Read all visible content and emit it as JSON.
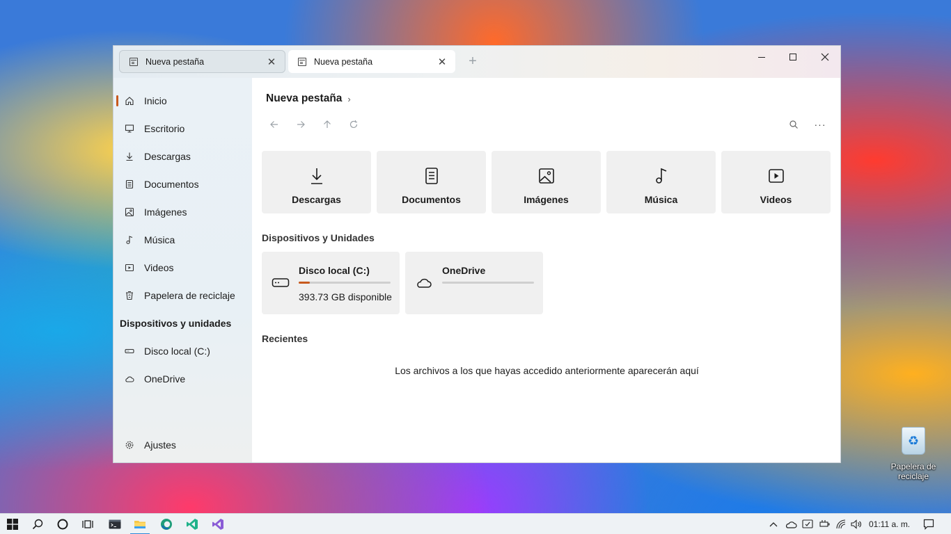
{
  "window": {
    "tabs": [
      {
        "title": "Nueva  pestaña",
        "active": false
      },
      {
        "title": "Nueva  pestaña",
        "active": true
      }
    ],
    "new_tab": "+"
  },
  "sidebar": {
    "items": [
      {
        "label": "Inicio",
        "icon": "home-icon"
      },
      {
        "label": "Escritorio",
        "icon": "desktop-icon"
      },
      {
        "label": "Descargas",
        "icon": "download-icon"
      },
      {
        "label": "Documentos",
        "icon": "document-icon"
      },
      {
        "label": "Imágenes",
        "icon": "image-icon"
      },
      {
        "label": "Música",
        "icon": "music-icon"
      },
      {
        "label": "Videos",
        "icon": "video-icon"
      },
      {
        "label": "Papelera de reciclaje",
        "icon": "recycle-bin-icon"
      }
    ],
    "devices_header": "Dispositivos y unidades",
    "devices": [
      {
        "label": "Disco local (C:)",
        "icon": "drive-icon"
      },
      {
        "label": "OneDrive",
        "icon": "cloud-icon"
      }
    ],
    "settings_label": "Ajustes"
  },
  "main": {
    "breadcrumb": "Nueva pestaña",
    "breadcrumb_chevron": "›",
    "quick_access": [
      {
        "label": "Descargas",
        "icon": "download-icon"
      },
      {
        "label": "Documentos",
        "icon": "document-icon"
      },
      {
        "label": "Imágenes",
        "icon": "image-icon"
      },
      {
        "label": "Música",
        "icon": "music-icon"
      },
      {
        "label": "Videos",
        "icon": "video-icon"
      }
    ],
    "devices_title": "Dispositivos y Unidades",
    "drives": [
      {
        "name": "Disco local (C:)",
        "free": "393.73 GB disponibles",
        "used_fraction": 0.12,
        "icon": "drive-icon"
      },
      {
        "name": "OneDrive",
        "free": "",
        "used_fraction": 0,
        "icon": "cloud-icon"
      }
    ],
    "recents_title": "Recientes",
    "recents_empty": "Los archivos a los que hayas accedido anteriormente aparecerán aquí"
  },
  "desktop": {
    "recycle_bin_label": "Papelera de reciclaje"
  },
  "taskbar": {
    "clock": "01:11 a. m."
  },
  "colors": {
    "accent": "#c85a1e",
    "taskbar_active": "#2b88d8"
  }
}
